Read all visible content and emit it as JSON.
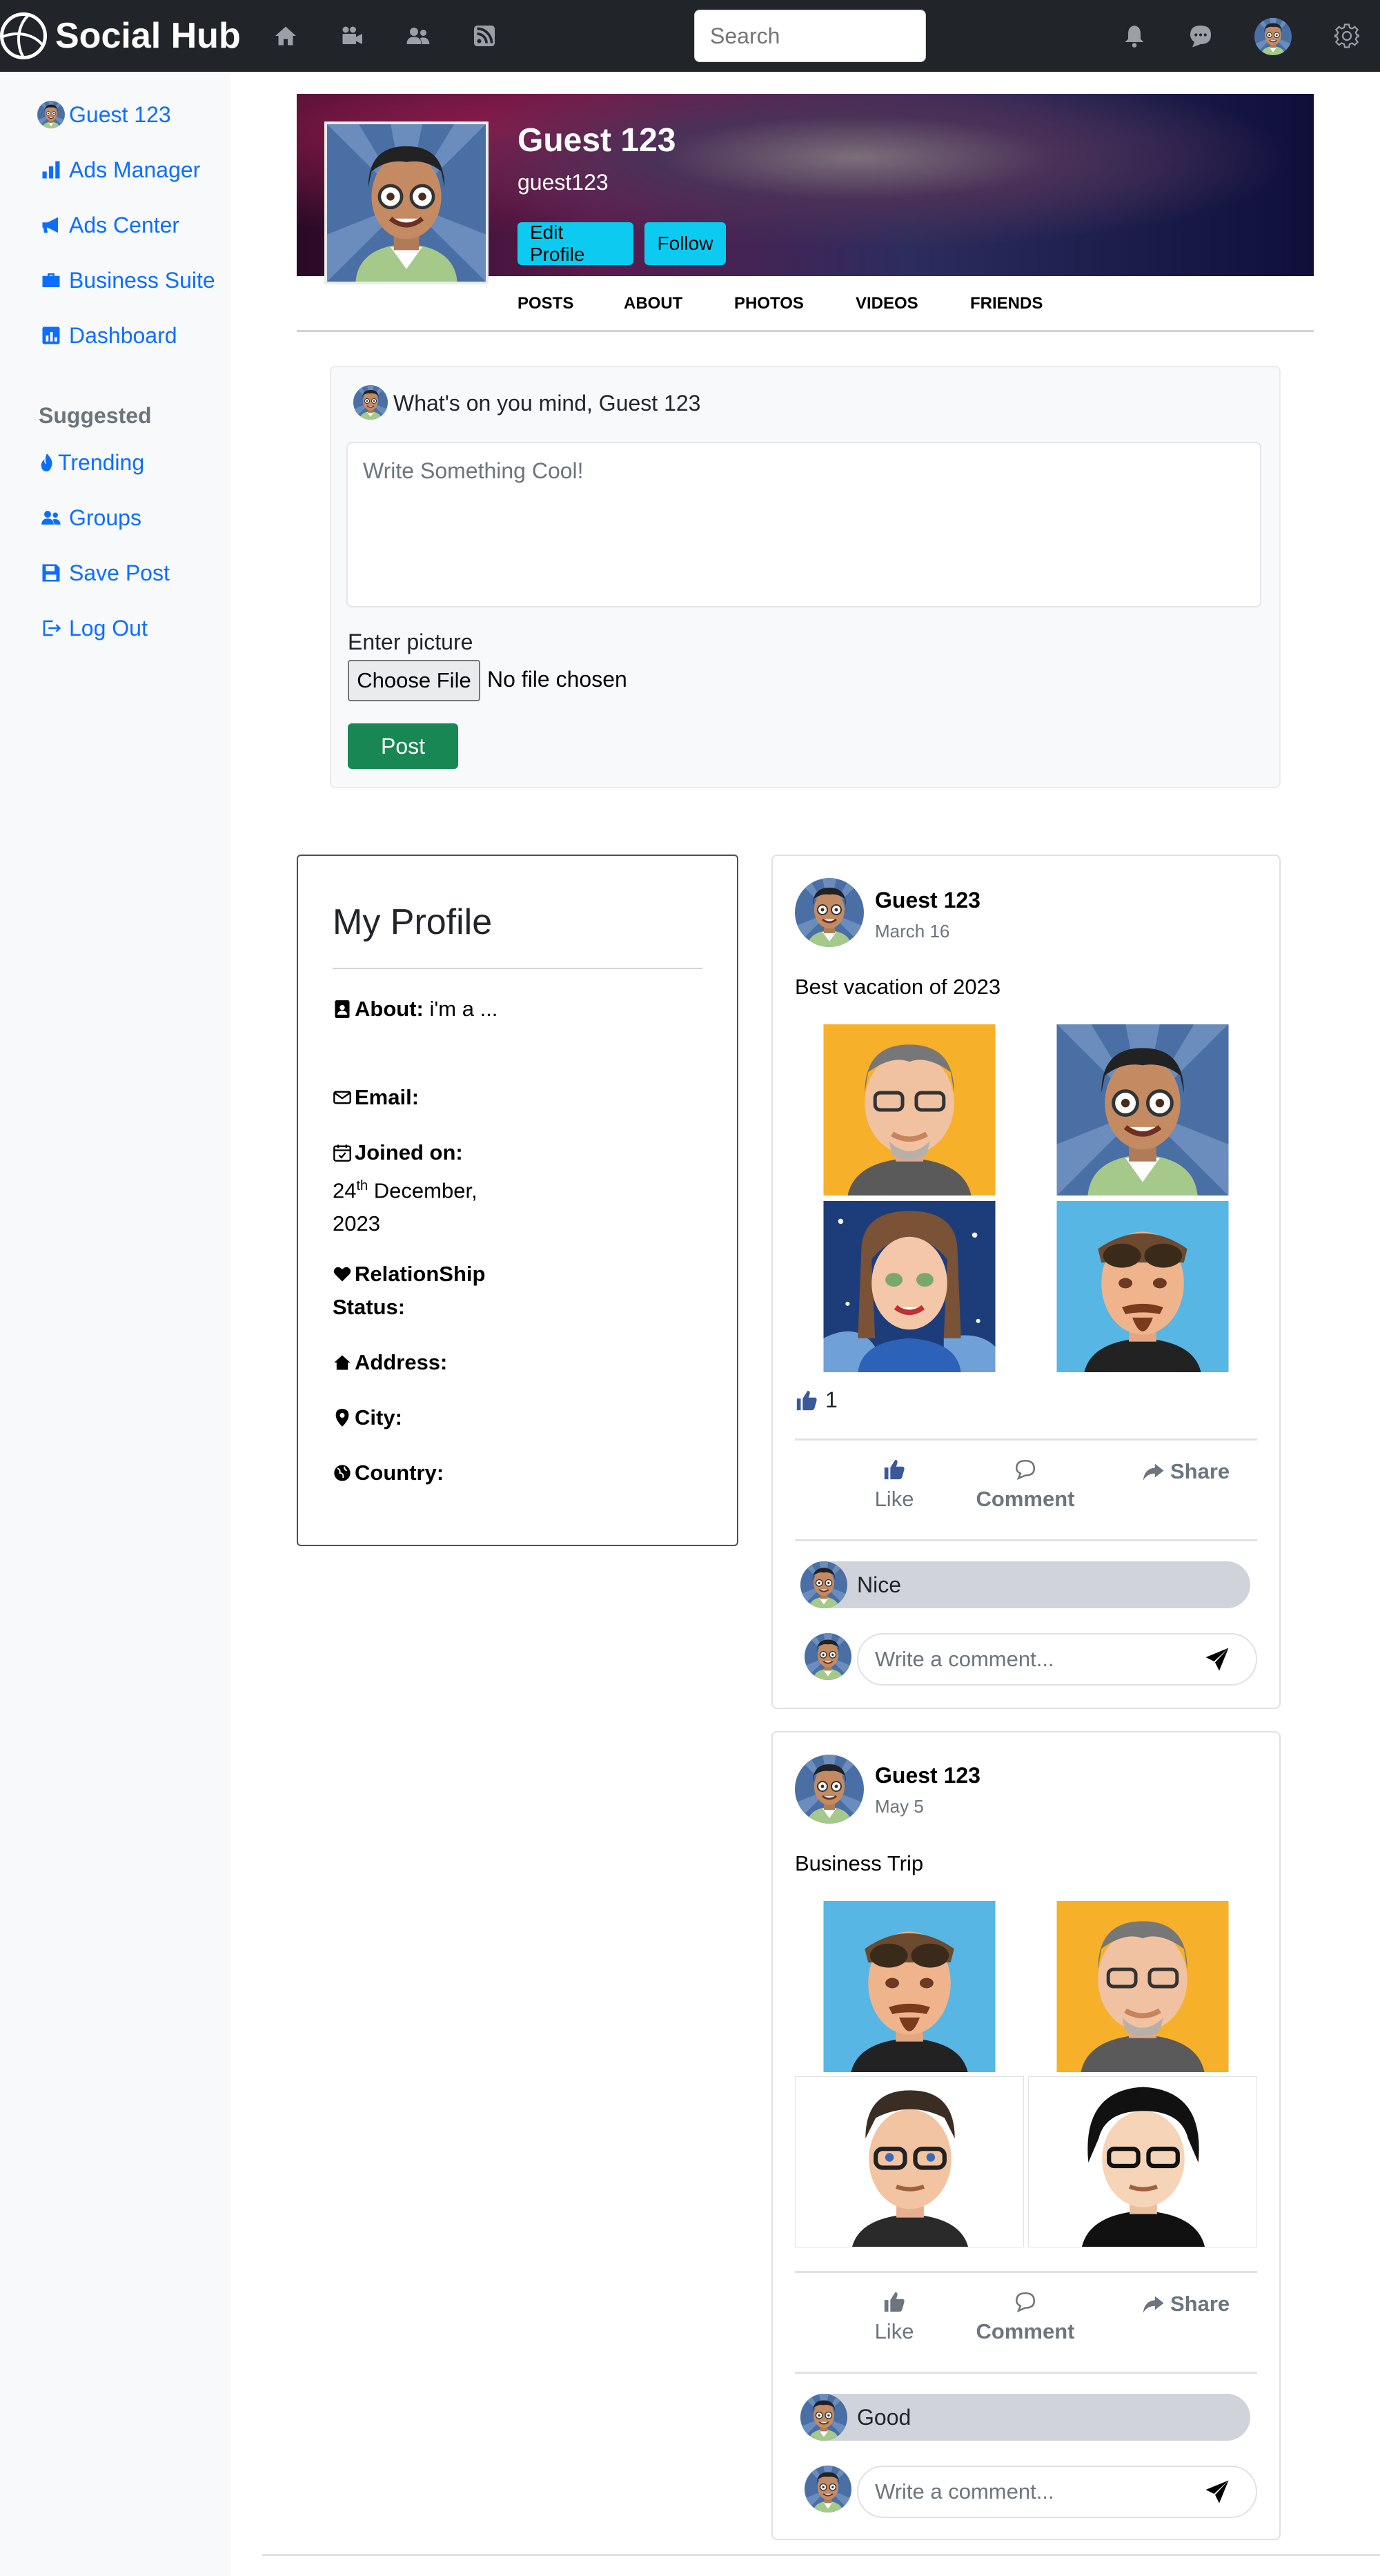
{
  "navbar": {
    "brand": "Social Hub",
    "search_placeholder": "Search",
    "icons": [
      "home-icon",
      "video-icon",
      "friends-icon",
      "feed-icon",
      "bell-icon",
      "chat-icon",
      "gear-icon"
    ]
  },
  "sidebar": {
    "items": [
      {
        "label": "Guest 123",
        "icon": "avatar"
      },
      {
        "label": "Ads Manager",
        "icon": "bar-chart-icon"
      },
      {
        "label": "Ads Center",
        "icon": "megaphone-icon"
      },
      {
        "label": "Business Suite",
        "icon": "briefcase-icon"
      },
      {
        "label": "Dashboard",
        "icon": "dashboard-icon"
      }
    ],
    "suggested_heading": "Suggested",
    "suggested": [
      {
        "label": "Trending",
        "icon": "fire-icon"
      },
      {
        "label": "Groups",
        "icon": "people-icon"
      },
      {
        "label": "Save Post",
        "icon": "floppy-icon"
      },
      {
        "label": "Log Out",
        "icon": "logout-icon"
      }
    ]
  },
  "profile": {
    "name": "Guest 123",
    "handle": "guest123",
    "edit_label": "Edit Profile",
    "follow_label": "Follow",
    "tabs": [
      "POSTS",
      "ABOUT",
      "PHOTOS",
      "VIDEOS",
      "FRIENDS"
    ]
  },
  "composer": {
    "title": "What's on you mind, Guest 123",
    "placeholder": "Write Something Cool!",
    "picture_label": "Enter picture",
    "choose_file": "Choose File",
    "no_file": "No file chosen",
    "post_label": "Post"
  },
  "my_profile": {
    "title": "My Profile",
    "about_label": "About:",
    "about_value": "i'm a ...",
    "email_label": "Email:",
    "joined_label": "Joined on:",
    "joined_day": "24",
    "joined_suffix": "th",
    "joined_rest": " December, 2023",
    "relationship_label": "RelationShip Status:",
    "address_label": "Address:",
    "city_label": "City:",
    "country_label": "Country:"
  },
  "posts": [
    {
      "author": "Guest 123",
      "date": "March 16",
      "text": "Best vacation of 2023",
      "likes": "1",
      "like_label": "Like",
      "comment_label": "Comment",
      "share_label": "Share",
      "comment": "Nice",
      "comment_placeholder": "Write a comment..."
    },
    {
      "author": "Guest 123",
      "date": "May 5",
      "text": "Business Trip",
      "like_label": "Like",
      "comment_label": "Comment",
      "share_label": "Share",
      "comment": "Good",
      "comment_placeholder": "Write a comment..."
    }
  ],
  "colors": {
    "navbar": "#212529",
    "link": "#0d6efd",
    "cyan_button": "#0dcaf0",
    "post_button": "#198754"
  }
}
